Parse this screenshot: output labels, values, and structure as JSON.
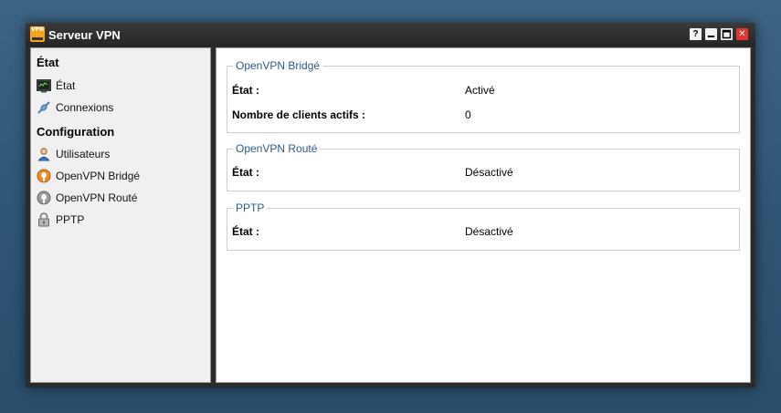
{
  "window": {
    "title": "Serveur VPN",
    "app_icon_text": "VPN",
    "controls": {
      "help": "?",
      "minimize": "",
      "maximize": "",
      "close": "✕"
    }
  },
  "sidebar": {
    "sections": [
      {
        "heading": "État",
        "items": [
          {
            "label": "État",
            "icon": "monitor-icon"
          },
          {
            "label": "Connexions",
            "icon": "connection-icon"
          }
        ]
      },
      {
        "heading": "Configuration",
        "items": [
          {
            "label": "Utilisateurs",
            "icon": "user-icon"
          },
          {
            "label": "OpenVPN Bridgé",
            "icon": "openvpn-orange-icon"
          },
          {
            "label": "OpenVPN Routé",
            "icon": "openvpn-gray-icon"
          },
          {
            "label": "PPTP",
            "icon": "lock-icon"
          }
        ]
      }
    ]
  },
  "main": {
    "groups": [
      {
        "title": "OpenVPN Bridgé",
        "rows": [
          {
            "label": "État :",
            "value": "Activé"
          },
          {
            "label": "Nombre de clients actifs :",
            "value": "0"
          }
        ]
      },
      {
        "title": "OpenVPN Routé",
        "rows": [
          {
            "label": "État :",
            "value": "Désactivé"
          }
        ]
      },
      {
        "title": "PPTP",
        "rows": [
          {
            "label": "État :",
            "value": "Désactivé"
          }
        ]
      }
    ]
  },
  "colors": {
    "desktop": "#2f5574",
    "titlebar": "#262626",
    "group_title": "#2b5a8c",
    "close_button": "#e8322d",
    "app_icon": "#f4a41f",
    "openvpn_orange": "#f08a24"
  }
}
